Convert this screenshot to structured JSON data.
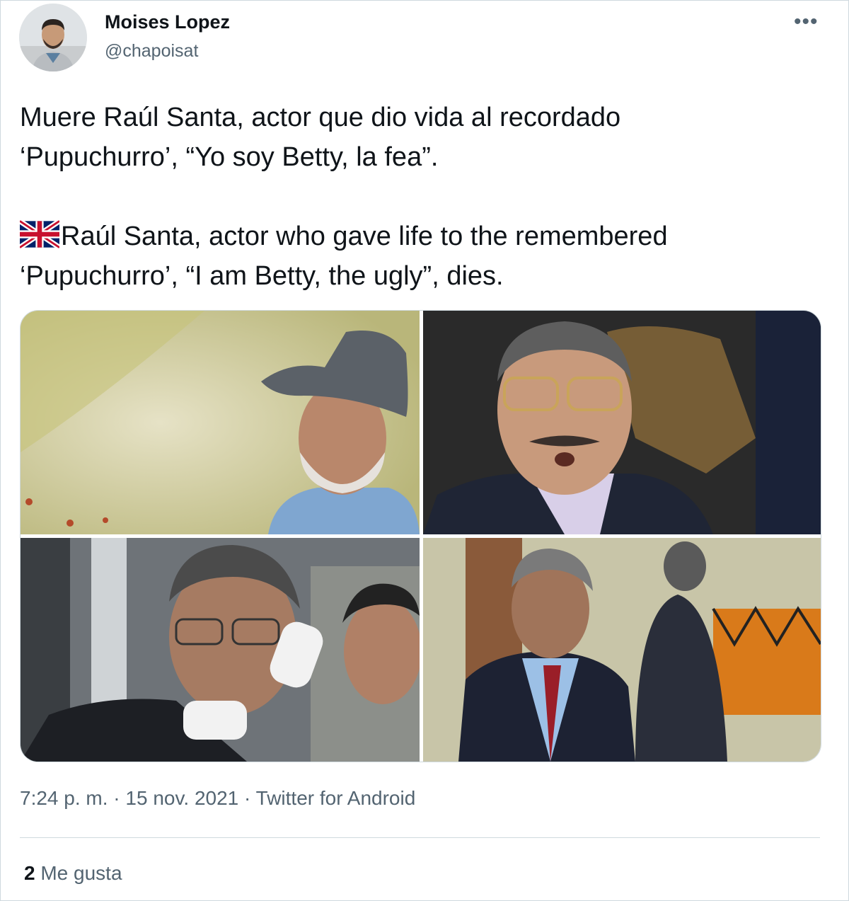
{
  "author": {
    "name": "Moises Lopez",
    "handle": "@chapoisat"
  },
  "tweet": {
    "spanish_text": "Muere Raúl Santa, actor que dio vida al recordado\n‘Pupuchurro’, “Yo soy Betty, la fea”.",
    "english_text": "Raúl Santa, actor who gave life to the remembered\n‘Pupuchurro’, “I am Betty, the ugly”, dies."
  },
  "more_icon": "•••",
  "meta": {
    "time": "7:24 p. m.",
    "sep1": " · ",
    "date": "15 nov. 2021",
    "sep2": " · ",
    "source": "Twitter for Android"
  },
  "engagement": {
    "likes_count": "2",
    "likes_label": " Me gusta"
  },
  "icons": [
    "avatar",
    "more-icon",
    "uk-flag-icon"
  ],
  "colors": {
    "text": "#0f1419",
    "secondary": "#536471",
    "border": "#cfd9de"
  }
}
